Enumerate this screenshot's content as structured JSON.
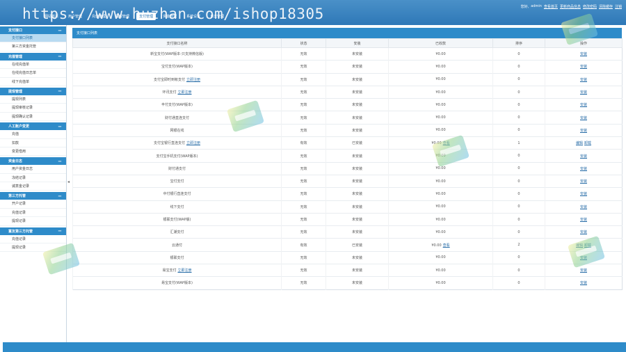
{
  "watermark": "https://www.huzhan.com/ishop18305",
  "topnav": [
    "网站首页",
    "用户管理",
    "充值管理",
    "提现管理",
    "支付管理",
    "资金管理",
    "系统设置",
    "日志管理"
  ],
  "userbar": {
    "greeting": "您好,",
    "username": "admin",
    "links": [
      "查看首页",
      "更新商品信息",
      "修改密码",
      "清除缓存",
      "注销"
    ]
  },
  "sidebar": [
    {
      "title": "支付接口",
      "items": [
        "支付接口列表",
        "第三方资金托管"
      ]
    },
    {
      "title": "充值管理",
      "items": [
        "在线充值单",
        "在线充值日志单",
        "线下充值单"
      ]
    },
    {
      "title": "提现管理",
      "items": [
        "提现列表",
        "提现审核记录",
        "提现确认记录"
      ]
    },
    {
      "title": "人工账户变更",
      "items": [
        "充值",
        "扣款",
        "变更借用"
      ]
    },
    {
      "title": "资金日志",
      "items": [
        "用户资金日志",
        "冻结记录",
        "诚意金记录"
      ]
    },
    {
      "title": "第三方托管",
      "items": [
        "开户记录",
        "充值记录",
        "提现记录"
      ]
    },
    {
      "title": "富友第三方托管",
      "items": [
        "充值记录",
        "提现记录"
      ]
    }
  ],
  "panel_title": "支付接口列表",
  "columns": [
    "支付接口名称",
    "状态",
    "安装",
    "已收款",
    "排序",
    "操作"
  ],
  "rows": [
    {
      "name": "新宝支付(WAP版本-只支持微信版)",
      "link": "",
      "status": "无效",
      "install": "未安装",
      "amount": "¥0.00",
      "view": "",
      "sort": "0",
      "ops": [
        "安装"
      ]
    },
    {
      "name": "宝付支付(WAP版本)",
      "link": "",
      "status": "无效",
      "install": "未安装",
      "amount": "¥0.00",
      "view": "",
      "sort": "0",
      "ops": [
        "安装"
      ]
    },
    {
      "name": "支付宝即时到帐支付",
      "link": "立即注册",
      "status": "无效",
      "install": "未安装",
      "amount": "¥0.00",
      "view": "",
      "sort": "0",
      "ops": [
        "安装"
      ]
    },
    {
      "name": "环讯支付",
      "link": "立即注册",
      "status": "无效",
      "install": "未安装",
      "amount": "¥0.00",
      "view": "",
      "sort": "0",
      "ops": [
        "安装"
      ]
    },
    {
      "name": "丰付支付(WAP版本)",
      "link": "",
      "status": "无效",
      "install": "未安装",
      "amount": "¥0.00",
      "view": "",
      "sort": "0",
      "ops": [
        "安装"
      ]
    },
    {
      "name": "财付通直连支付",
      "link": "",
      "status": "无效",
      "install": "未安装",
      "amount": "¥0.00",
      "view": "",
      "sort": "0",
      "ops": [
        "安装"
      ]
    },
    {
      "name": "网银在线",
      "link": "",
      "status": "无效",
      "install": "未安装",
      "amount": "¥0.00",
      "view": "",
      "sort": "0",
      "ops": [
        "安装"
      ]
    },
    {
      "name": "支付宝银行直连支付",
      "link": "立即注册",
      "status": "有效",
      "install": "已安装",
      "amount": "¥0.00",
      "view": "查看",
      "sort": "1",
      "ops": [
        "编辑",
        "卸载"
      ]
    },
    {
      "name": "支付宝手机支付(WAP版本)",
      "link": "",
      "status": "无效",
      "install": "未安装",
      "amount": "¥0.00",
      "view": "",
      "sort": "0",
      "ops": [
        "安装"
      ]
    },
    {
      "name": "财付通支付",
      "link": "",
      "status": "无效",
      "install": "未安装",
      "amount": "¥0.00",
      "view": "",
      "sort": "0",
      "ops": [
        "安装"
      ]
    },
    {
      "name": "宝付支付",
      "link": "",
      "status": "无效",
      "install": "未安装",
      "amount": "¥0.00",
      "view": "",
      "sort": "0",
      "ops": [
        "安装"
      ]
    },
    {
      "name": "中付银行直连支付",
      "link": "",
      "status": "无效",
      "install": "未安装",
      "amount": "¥0.00",
      "view": "",
      "sort": "0",
      "ops": [
        "安装"
      ]
    },
    {
      "name": "线下支付",
      "link": "",
      "status": "无效",
      "install": "未安装",
      "amount": "¥0.00",
      "view": "",
      "sort": "0",
      "ops": [
        "安装"
      ]
    },
    {
      "name": "银联支付(WAP版)",
      "link": "",
      "status": "无效",
      "install": "未安装",
      "amount": "¥0.00",
      "view": "",
      "sort": "0",
      "ops": [
        "安装"
      ]
    },
    {
      "name": "汇潮支付",
      "link": "",
      "status": "无效",
      "install": "未安装",
      "amount": "¥0.00",
      "view": "",
      "sort": "0",
      "ops": [
        "安装"
      ]
    },
    {
      "name": "云通付",
      "link": "",
      "status": "有效",
      "install": "已安装",
      "amount": "¥0.00",
      "view": "查看",
      "sort": "2",
      "ops": [
        "编辑",
        "卸载"
      ]
    },
    {
      "name": "银联支付",
      "link": "",
      "status": "无效",
      "install": "未安装",
      "amount": "¥0.00",
      "view": "",
      "sort": "0",
      "ops": [
        "安装"
      ]
    },
    {
      "name": "易宝支付",
      "link": "立即注册",
      "status": "无效",
      "install": "未安装",
      "amount": "¥0.00",
      "view": "",
      "sort": "0",
      "ops": [
        "安装"
      ]
    },
    {
      "name": "易宝支付(WAP版本)",
      "link": "",
      "status": "无效",
      "install": "未安装",
      "amount": "¥0.00",
      "view": "",
      "sort": "0",
      "ops": [
        "安装"
      ]
    }
  ]
}
